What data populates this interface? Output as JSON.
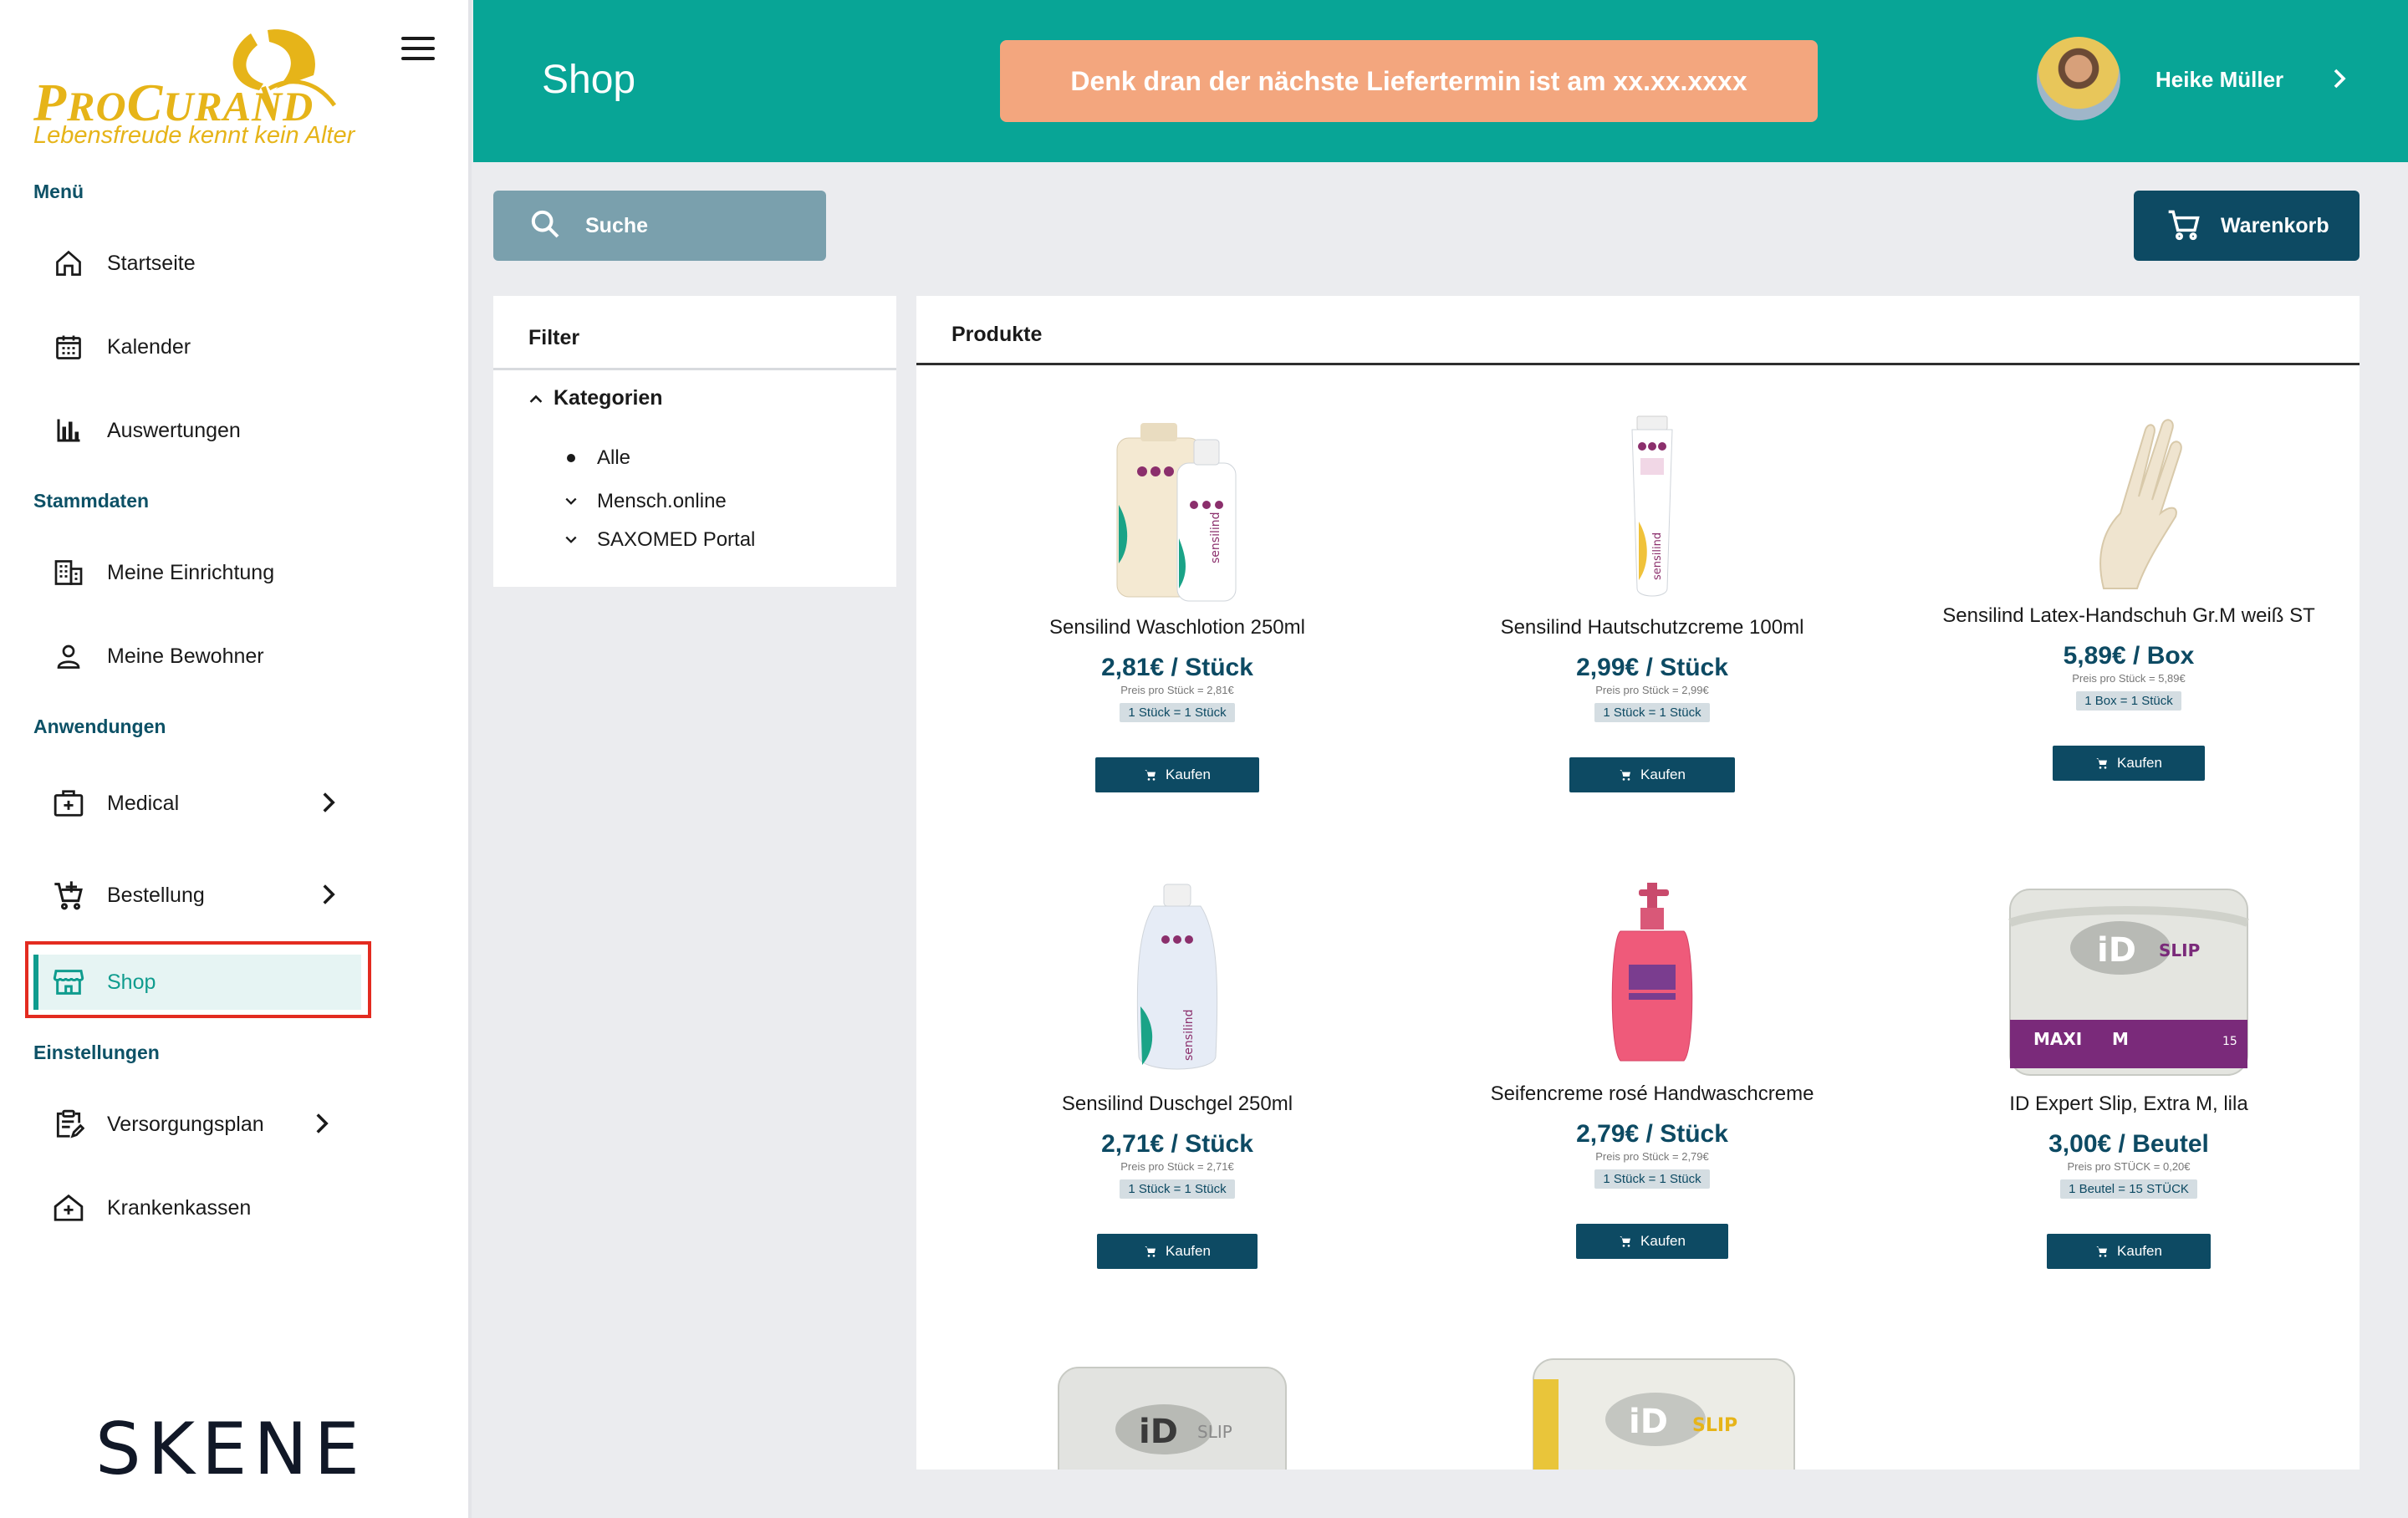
{
  "brand": {
    "name_first_big": "P",
    "name_first_rest": "RO",
    "name_second_big": "C",
    "name_second_rest": "URAND",
    "tagline": "Lebensfreude kennt kein Alter",
    "footer_logo": "SKENE"
  },
  "sidebar": {
    "sections": {
      "menu": "Menü",
      "stammdaten": "Stammdaten",
      "anwendungen": "Anwendungen",
      "einstellungen": "Einstellungen"
    },
    "items": {
      "startseite": "Startseite",
      "kalender": "Kalender",
      "auswertungen": "Auswertungen",
      "einrichtung": "Meine Einrichtung",
      "bewohner": "Meine Bewohner",
      "medical": "Medical",
      "bestellung": "Bestellung",
      "shop": "Shop",
      "versorgungsplan": "Versorgungsplan",
      "krankenkassen": "Krankenkassen"
    },
    "active_item": "shop"
  },
  "header": {
    "title": "Shop",
    "banner": "Denk dran der nächste Liefertermin ist am xx.xx.xxxx",
    "user_name": "Heike Müller"
  },
  "toolbar": {
    "search_label": "Suche",
    "cart_label": "Warenkorb"
  },
  "filter": {
    "title": "Filter",
    "category_head": "Kategorien",
    "categories": [
      "Alle",
      "Mensch.online",
      "SAXOMED Portal"
    ]
  },
  "products": {
    "title": "Produkte",
    "buy_label": "Kaufen",
    "items": [
      {
        "name": "Sensilind Waschlotion 250ml",
        "price": "2,81€ / Stück",
        "per": "Preis pro Stück = 2,81€",
        "unit": "1 Stück = 1 Stück"
      },
      {
        "name": "Sensilind Hautschutzcreme 100ml",
        "price": "2,99€ / Stück",
        "per": "Preis pro Stück = 2,99€",
        "unit": "1 Stück = 1 Stück"
      },
      {
        "name": "Sensilind Latex-Handschuh Gr.M weiß ST",
        "price": "5,89€ / Box",
        "per": "Preis pro Stück = 5,89€",
        "unit": "1 Box = 1 Stück"
      },
      {
        "name": "Sensilind Duschgel 250ml",
        "price": "2,71€ / Stück",
        "per": "Preis pro Stück = 2,71€",
        "unit": "1 Stück = 1 Stück"
      },
      {
        "name": "Seifencreme rosé Handwaschcreme",
        "price": "2,79€ / Stück",
        "per": "Preis pro Stück = 2,79€",
        "unit": "1 Stück = 1 Stück"
      },
      {
        "name": "ID Expert Slip, Extra M, lila",
        "price": "3,00€ / Beutel",
        "per": "Preis pro STÜCK = 0,20€",
        "unit": "1 Beutel = 15 STÜCK"
      }
    ],
    "package_labels": {
      "brand": "iD",
      "slip": "SLIP",
      "maxi": "MAXI",
      "size": "M",
      "count": "15",
      "product_brand": "sensilind"
    }
  },
  "colors": {
    "teal": "#08a596",
    "navy": "#0d4a63",
    "banner": "#f3a67e",
    "gold": "#e6b419",
    "highlight": "#e32b20"
  }
}
